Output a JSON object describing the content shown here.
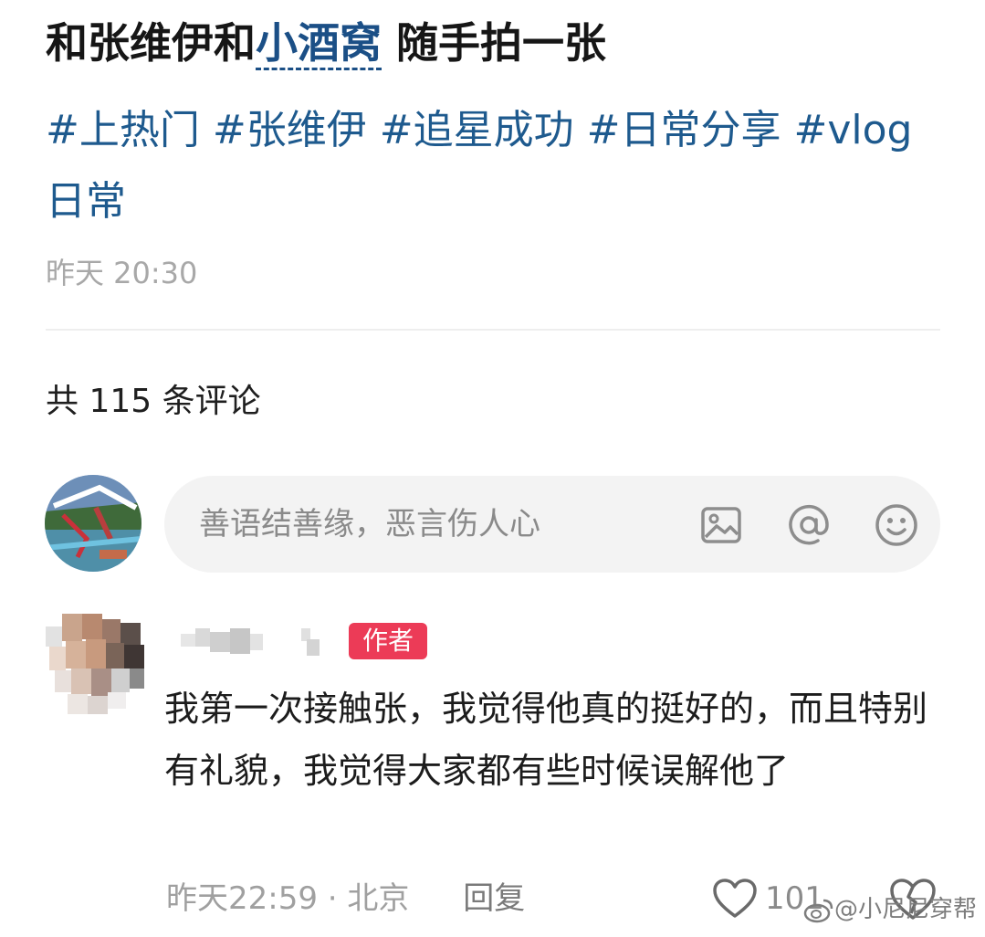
{
  "post": {
    "title_part1": "和张维伊和",
    "title_mention": "小酒窝",
    "title_part2": " 随手拍一张",
    "tags": [
      "#上热门",
      "#张维伊",
      "#追星成功",
      "#日常分享",
      "#vlog日常"
    ],
    "time": "昨天 20:30"
  },
  "comments_header": {
    "count_text": "共 115 条评论"
  },
  "comment_input": {
    "placeholder": "善语结善缘，恶言伤人心",
    "icons": [
      "image-icon",
      "at-icon",
      "emoji-icon"
    ]
  },
  "comment": {
    "badge": "作者",
    "text": "我第一次接触张，我觉得他真的挺好的，而且特别有礼貌，我觉得大家都有些时候误解他了",
    "time": "昨天22:59",
    "location": "北京",
    "reply_label": "回复",
    "likes": "101"
  },
  "watermark": {
    "text": "@小尼尼穿帮"
  },
  "colors": {
    "tag_blue": "#1e5a8e",
    "badge_red": "#ec3b57",
    "meta_gray": "#a0a0a0"
  }
}
